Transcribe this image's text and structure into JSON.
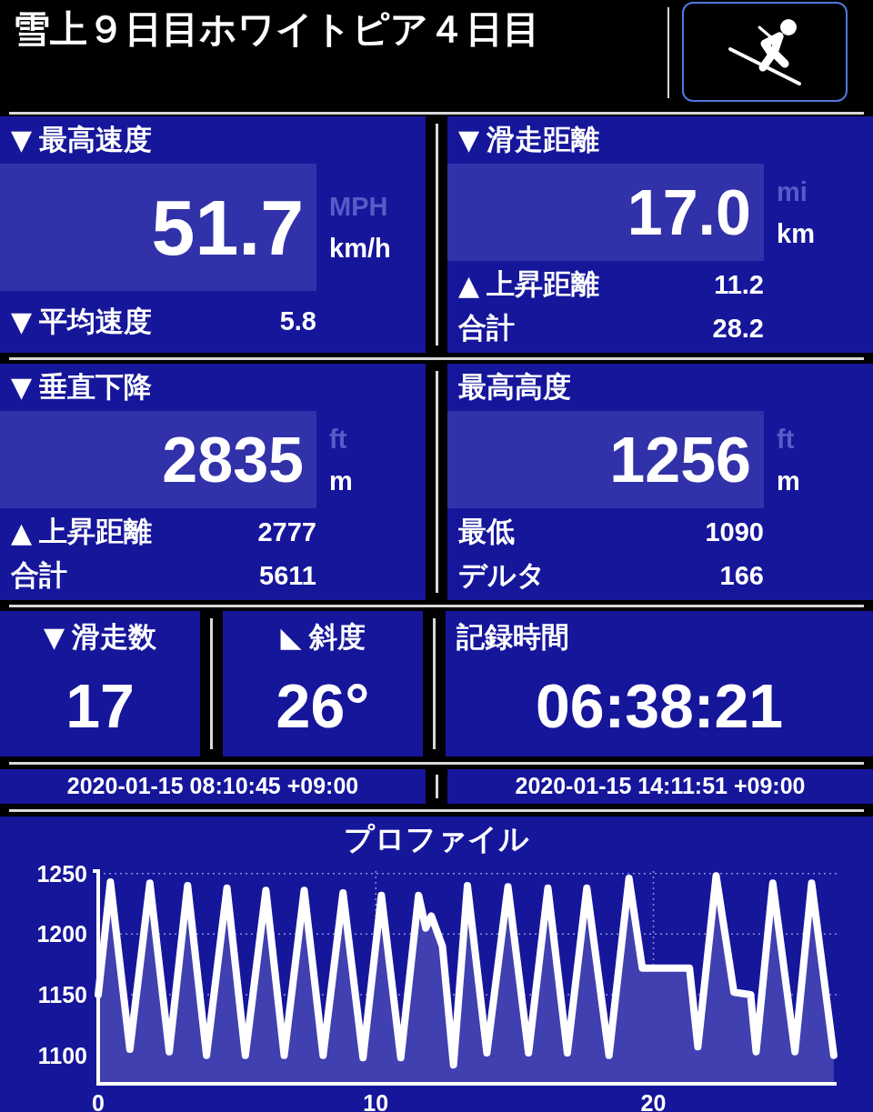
{
  "title": "雪上９日目ホワイトピア４日目",
  "panels": [
    {
      "label": "最高速度",
      "marker": "▼",
      "value": "51.7",
      "units": [
        {
          "label": "MPH",
          "selected": false
        },
        {
          "label": "km/h",
          "selected": true
        }
      ],
      "rows": [
        {
          "marker": "▼",
          "label": "平均速度",
          "value": "5.8"
        }
      ]
    },
    {
      "label": "滑走距離",
      "marker": "▼",
      "value": "17.0",
      "units": [
        {
          "label": "mi",
          "selected": false
        },
        {
          "label": "km",
          "selected": true
        }
      ],
      "rows": [
        {
          "marker": "▲",
          "label": "上昇距離",
          "value": "11.2"
        },
        {
          "label": "合計",
          "value": "28.2"
        }
      ]
    },
    {
      "label": "垂直下降",
      "marker": "▼",
      "value": "2835",
      "units": [
        {
          "label": "ft",
          "selected": false
        },
        {
          "label": "m",
          "selected": true
        }
      ],
      "rows": [
        {
          "marker": "▲",
          "label": "上昇距離",
          "value": "2777"
        },
        {
          "label": "合計",
          "value": "5611"
        }
      ]
    },
    {
      "label": "最高高度",
      "value": "1256",
      "units": [
        {
          "label": "ft",
          "selected": false
        },
        {
          "label": "m",
          "selected": true
        }
      ],
      "rows": [
        {
          "label": "最低",
          "value": "1090"
        },
        {
          "label": "デルタ",
          "value": "166"
        }
      ]
    }
  ],
  "small_panels": [
    {
      "label": "滑走数",
      "marker": "▼",
      "value": "17"
    },
    {
      "label": "斜度",
      "marker": "◣",
      "value": "26°"
    },
    {
      "label": "記録時間",
      "value": "06:38:21"
    }
  ],
  "times": [
    "2020-01-15 08:10:45 +09:00",
    "2020-01-15 14:11:51 +09:00"
  ],
  "profile": {
    "chart_data": {
      "type": "area",
      "title": "プロファイル",
      "x": [
        0,
        0.44,
        1.14,
        1.86,
        2.56,
        3.22,
        3.9,
        4.64,
        5.3,
        6.04,
        6.7,
        7.42,
        8.1,
        8.82,
        9.54,
        10.2,
        10.9,
        11.54,
        11.8,
        12.0,
        12.4,
        12.8,
        13.3,
        14.0,
        14.76,
        15.5,
        16.2,
        16.9,
        17.6,
        18.4,
        19.12,
        19.6,
        21.3,
        21.6,
        22.26,
        22.9,
        23.5,
        23.7,
        24.3,
        25.1,
        25.7,
        26.5
      ],
      "series": [
        {
          "color": "#ffffff",
          "values": [
            1150,
            1243,
            1105,
            1242,
            1103,
            1240,
            1100,
            1238,
            1100,
            1236,
            1100,
            1236,
            1100,
            1234,
            1098,
            1232,
            1098,
            1232,
            1205,
            1215,
            1190,
            1092,
            1240,
            1102,
            1239,
            1102,
            1238,
            1102,
            1238,
            1100,
            1246,
            1172,
            1172,
            1107,
            1248,
            1152,
            1150,
            1103,
            1242,
            1103,
            1242,
            1100
          ]
        }
      ],
      "grid": true,
      "xlim": [
        0,
        26.6
      ],
      "ylim": [
        1078,
        1252
      ],
      "xticks": [
        0,
        10,
        20
      ],
      "yticks": [
        1100,
        1150,
        1200,
        1250
      ]
    }
  }
}
